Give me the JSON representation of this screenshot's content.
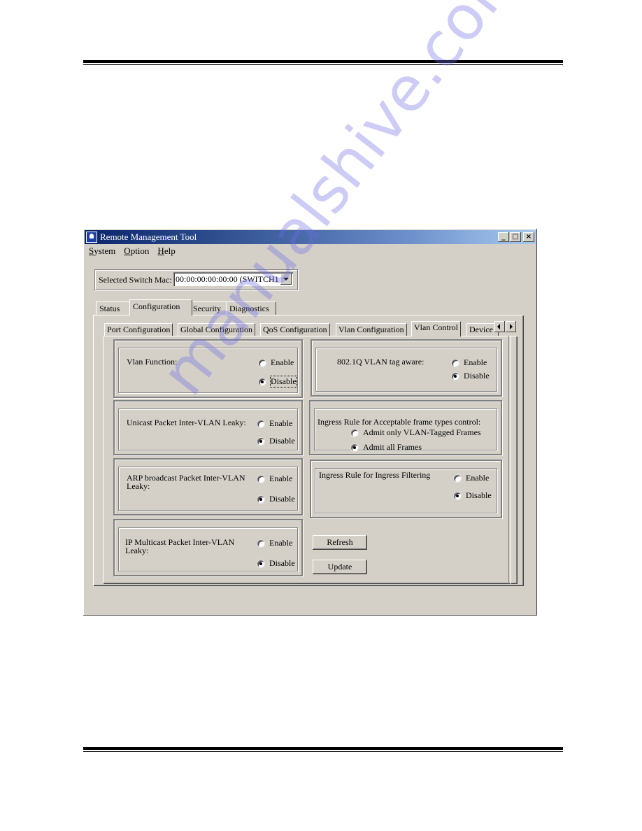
{
  "window": {
    "title": "Remote Management Tool",
    "controls": {
      "minimize": "_",
      "maximize": "□",
      "close": "×"
    }
  },
  "menu": [
    {
      "label": "System",
      "accel": "S"
    },
    {
      "label": "Option",
      "accel": "O"
    },
    {
      "label": "Help",
      "accel": "H"
    }
  ],
  "switch_selector": {
    "label": "Selected Switch Mac:",
    "value": "00:00:00:00:00:00 (SWITCH1"
  },
  "main_tabs": [
    {
      "label": "Status",
      "active": false
    },
    {
      "label": "Configuration",
      "active": true
    },
    {
      "label": "Security",
      "active": false
    },
    {
      "label": "Diagnostics",
      "active": false
    }
  ],
  "sub_tabs": [
    {
      "label": "Port Configuration",
      "active": false
    },
    {
      "label": "Global Configuration",
      "active": false
    },
    {
      "label": "QoS Configuration",
      "active": false
    },
    {
      "label": "Vlan Configuration",
      "active": false
    },
    {
      "label": "Vlan Control",
      "active": true
    },
    {
      "label": "Device",
      "active": false
    }
  ],
  "groups": {
    "vlan_function": {
      "label": "Vlan Function:",
      "options": [
        "Enable",
        "Disable"
      ],
      "selected": "Disable"
    },
    "unicast_leaky": {
      "label": "Unicast Packet Inter-VLAN Leaky:",
      "options": [
        "Enable",
        "Disable"
      ],
      "selected": "Disable"
    },
    "arp_leaky": {
      "label_line1": "ARP broadcast Packet Inter-VLAN",
      "label_line2": "Leaky:",
      "options": [
        "Enable",
        "Disable"
      ],
      "selected": "Disable"
    },
    "ip_multicast_leaky": {
      "label_line1": "IP Multicast Packet Inter-VLAN",
      "label_line2": "Leaky:",
      "options": [
        "Enable",
        "Disable"
      ],
      "selected": "Disable"
    },
    "tag_aware": {
      "label": "802.1Q VLAN tag aware:",
      "options": [
        "Enable",
        "Disable"
      ],
      "selected": "Disable"
    },
    "acceptable_frames": {
      "label": "Ingress Rule for Acceptable frame types control:",
      "options": [
        "Admit only VLAN-Tagged Frames",
        "Admit all Frames"
      ],
      "selected": "Admit all Frames"
    },
    "ingress_filtering": {
      "label": "Ingress Rule for Ingress Filtering",
      "options": [
        "Enable",
        "Disable"
      ],
      "selected": "Disable"
    }
  },
  "buttons": {
    "refresh": "Refresh",
    "update": "Update"
  },
  "watermark": "manualshive.com"
}
